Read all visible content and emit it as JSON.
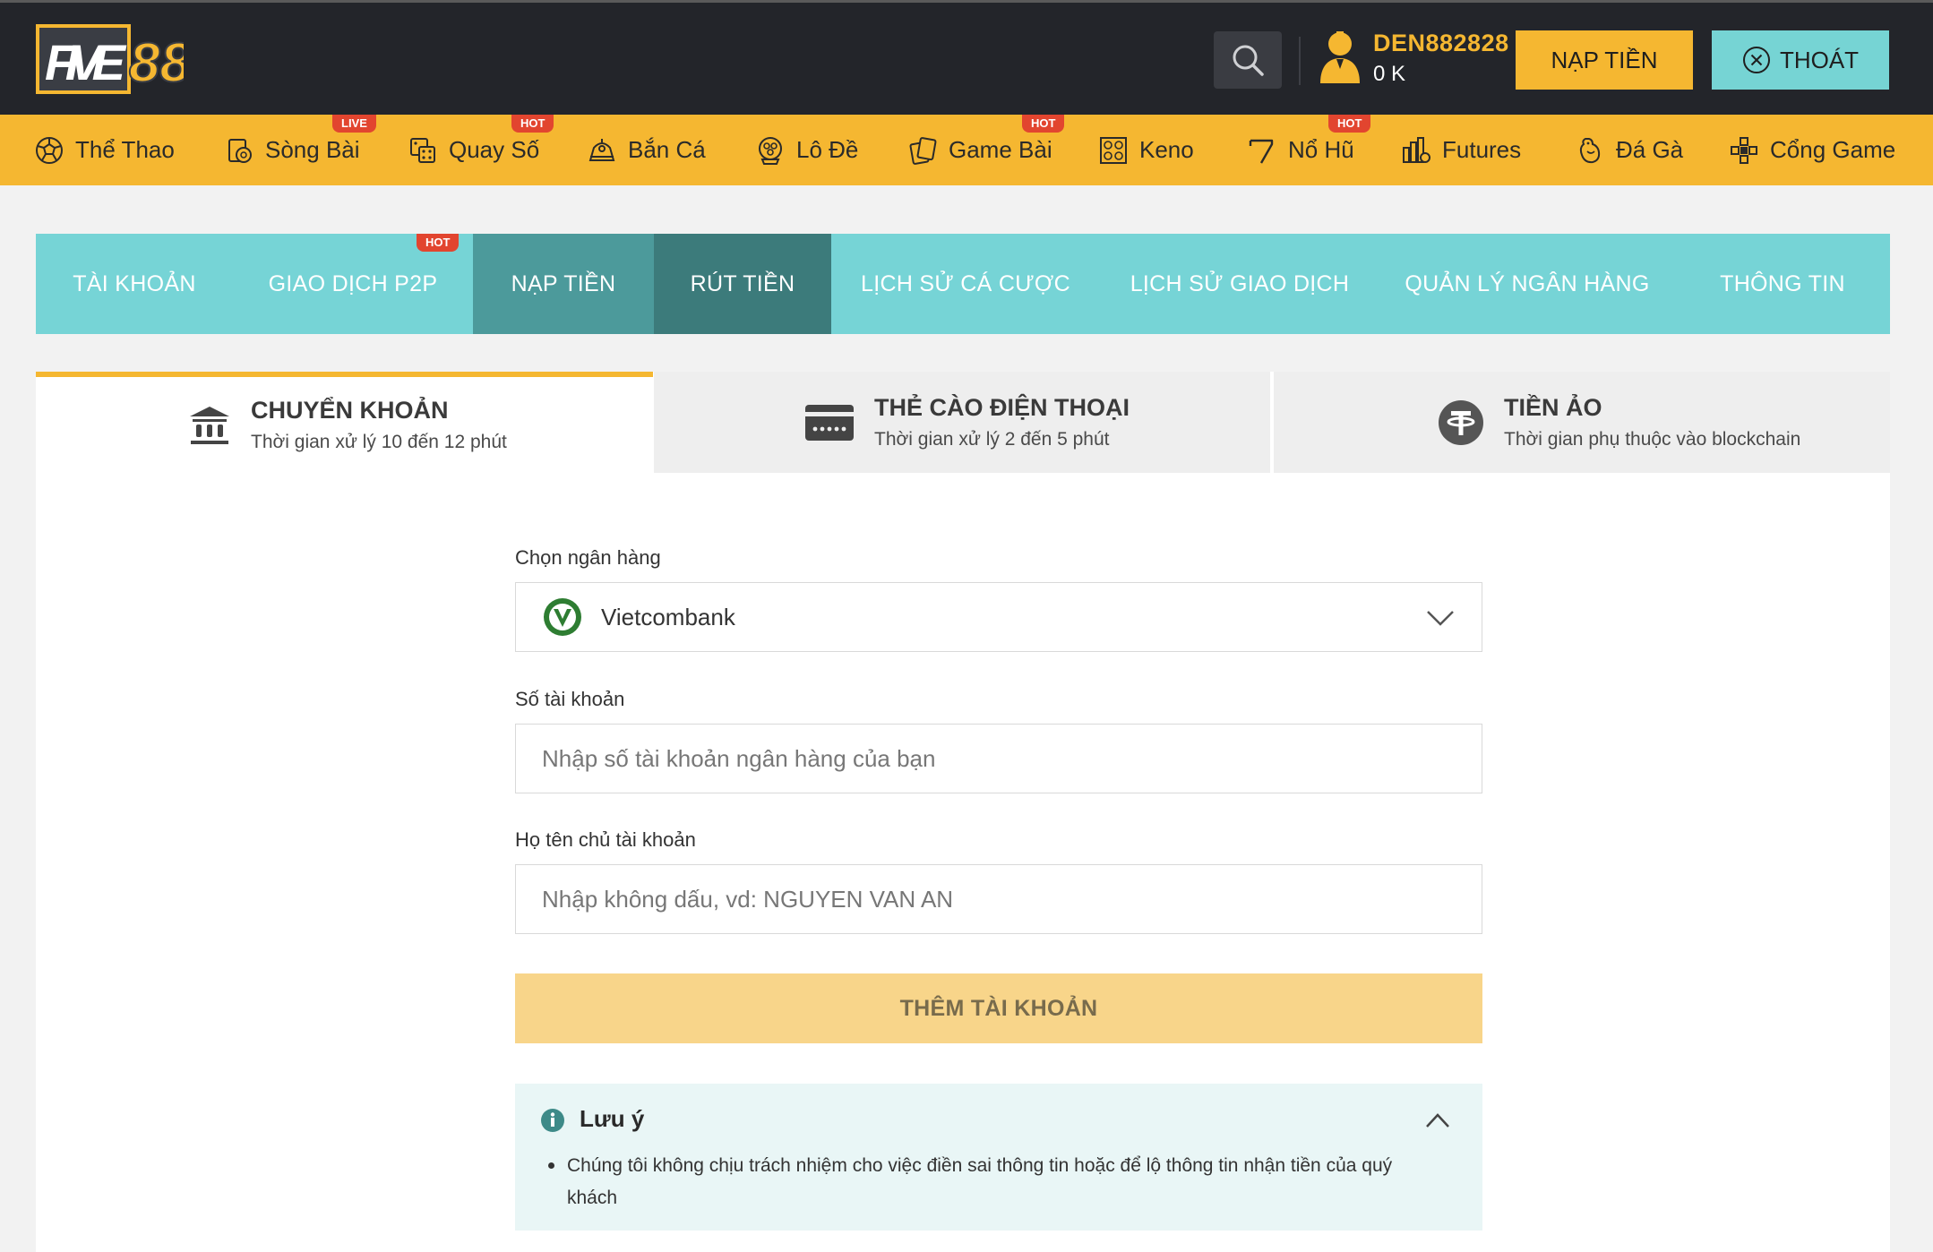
{
  "header": {
    "logo_text": "FIVE88",
    "username": "DEN882828",
    "balance": "0 K",
    "deposit_button": "NẠP TIỀN",
    "logout_button": "THOÁT"
  },
  "nav": {
    "items": [
      {
        "label": "Thể Thao",
        "icon": "soccer-ball-icon",
        "badge": ""
      },
      {
        "label": "Sòng Bài",
        "icon": "casino-chip-icon",
        "badge": "LIVE"
      },
      {
        "label": "Quay Số",
        "icon": "dice-icon",
        "badge": "HOT"
      },
      {
        "label": "Bắn Cá",
        "icon": "fish-shooter-icon",
        "badge": ""
      },
      {
        "label": "Lô Đề",
        "icon": "lottery-ball-icon",
        "badge": ""
      },
      {
        "label": "Game Bài",
        "icon": "cards-icon",
        "badge": "HOT"
      },
      {
        "label": "Keno",
        "icon": "keno-grid-icon",
        "badge": ""
      },
      {
        "label": "Nổ Hũ",
        "icon": "slot-seven-icon",
        "badge": "HOT"
      },
      {
        "label": "Futures",
        "icon": "bar-chart-icon",
        "badge": ""
      },
      {
        "label": "Đá Gà",
        "icon": "rooster-icon",
        "badge": ""
      },
      {
        "label": "Cổng Game",
        "icon": "gamepad-icon",
        "badge": ""
      }
    ]
  },
  "account_tabs": {
    "items": [
      {
        "label": "TÀI KHOẢN"
      },
      {
        "label": "GIAO DỊCH P2P"
      },
      {
        "label": "NẠP TIỀN"
      },
      {
        "label": "RÚT TIỀN"
      },
      {
        "label": "LỊCH SỬ CÁ CƯỢC"
      },
      {
        "label": "LỊCH SỬ GIAO DỊCH"
      },
      {
        "label": "QUẢN LÝ NGÂN HÀNG"
      },
      {
        "label": "THÔNG TIN"
      }
    ],
    "hot_badge": "HOT"
  },
  "methods": [
    {
      "title": "CHUYỂN KHOẢN",
      "subtitle": "Thời gian xử lý 10 đến 12 phút",
      "icon": "bank-icon"
    },
    {
      "title": "THẺ CÀO ĐIỆN THOẠI",
      "subtitle": "Thời gian xử lý 2 đến 5 phút",
      "icon": "phone-card-icon"
    },
    {
      "title": "TIỀN ẢO",
      "subtitle": "Thời gian phụ thuộc vào blockchain",
      "icon": "tether-icon"
    }
  ],
  "form": {
    "bank_label": "Chọn ngân hàng",
    "bank_value": "Vietcombank",
    "account_number_label": "Số tài khoản",
    "account_number_placeholder": "Nhập số tài khoản ngân hàng của bạn",
    "account_name_label": "Họ tên chủ tài khoản",
    "account_name_placeholder": "Nhập không dấu, vd: NGUYEN VAN AN",
    "add_button": "THÊM TÀI KHOẢN"
  },
  "note": {
    "title": "Lưu ý",
    "text": "Chúng tôi không chịu trách nhiệm cho việc điền sai thông tin hoặc để lộ thông tin nhận tiền của quý khách"
  },
  "colors": {
    "header_bg": "#23252a",
    "accent_yellow": "#f5b731",
    "accent_teal": "#76d4d6",
    "teal_dark": "#3c7b7b"
  }
}
